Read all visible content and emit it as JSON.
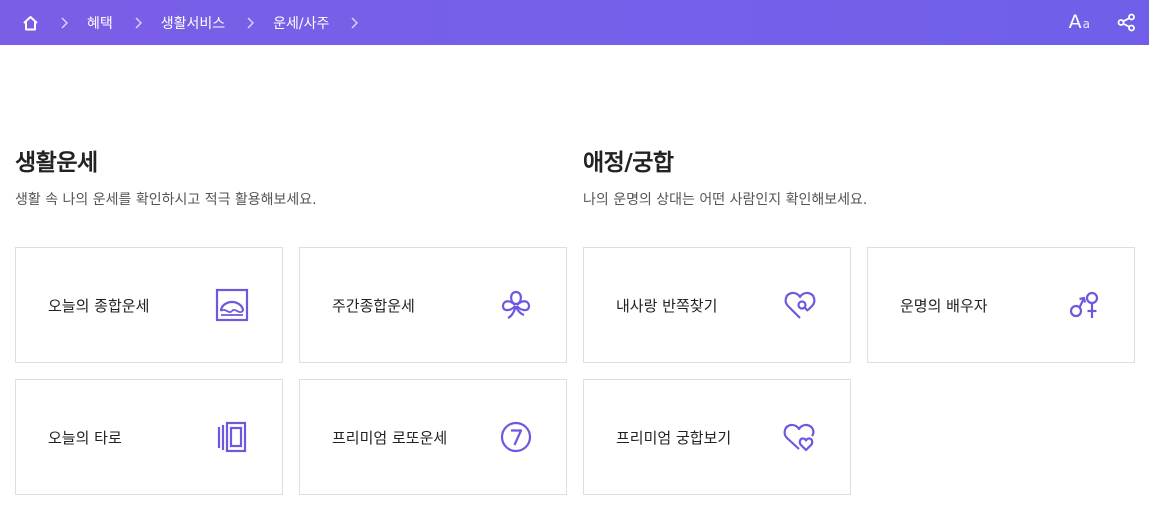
{
  "breadcrumb": {
    "home_icon": "home-icon",
    "items": [
      "혜택",
      "생활서비스",
      "운세/사주"
    ]
  },
  "toolbar": {
    "font_size_big": "A",
    "font_size_small": "a",
    "share_icon": "share-icon"
  },
  "sections": [
    {
      "title": "생활운세",
      "description": "생활 속 나의 운세를 확인하시고 적극 활용해보세요.",
      "cards": [
        {
          "label": "오늘의 종합운세",
          "icon": "sunrise-frame-icon"
        },
        {
          "label": "주간종합운세",
          "icon": "clover-icon"
        },
        {
          "label": "오늘의 타로",
          "icon": "tarot-cards-icon"
        },
        {
          "label": "프리미엄 로또운세",
          "icon": "lucky-seven-icon"
        }
      ]
    },
    {
      "title": "애정/궁합",
      "description": "나의 운명의 상대는 어떤 사람인지 확인해보세요.",
      "cards": [
        {
          "label": "내사랑 반쪽찾기",
          "icon": "heart-search-icon"
        },
        {
          "label": "운명의 배우자",
          "icon": "gender-symbols-icon"
        },
        {
          "label": "프리미엄 궁합보기",
          "icon": "double-heart-icon"
        }
      ]
    }
  ],
  "colors": {
    "header": "#7460ea",
    "icon": "#6e58e0",
    "border": "#dedede"
  }
}
